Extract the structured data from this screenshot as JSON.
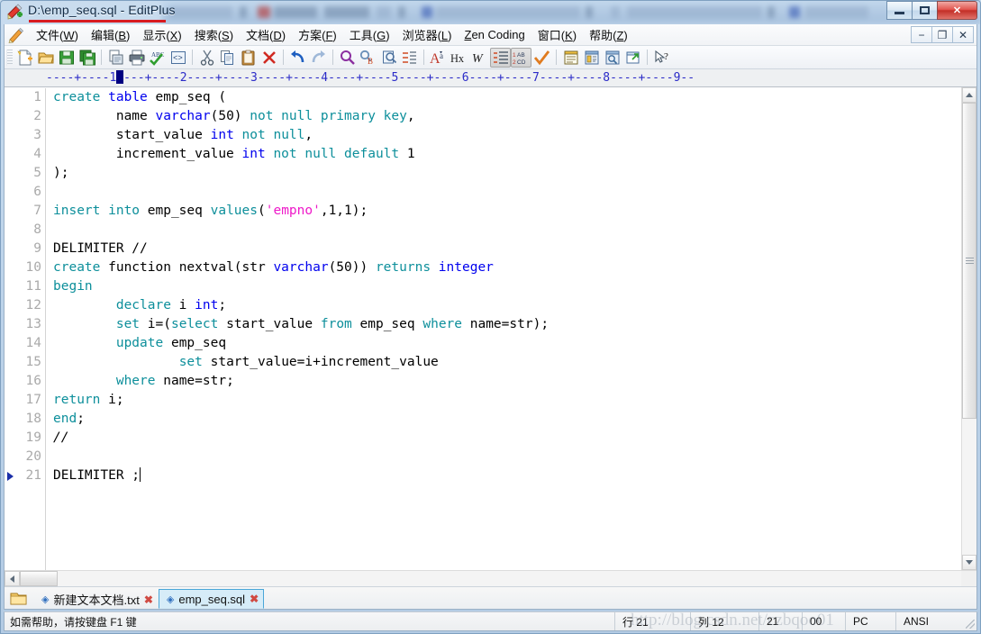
{
  "window": {
    "title": "D:\\emp_seq.sql - EditPlus",
    "app_icon": "editplus-icon",
    "minimize_label": "",
    "maximize_label": "",
    "close_label": "✕"
  },
  "menubar": {
    "leading_icon": "pencil-icon",
    "items": [
      {
        "name": "file",
        "text": "文件(W)",
        "accel": "W"
      },
      {
        "name": "edit",
        "text": "编辑(B)",
        "accel": "B"
      },
      {
        "name": "view",
        "text": "显示(X)",
        "accel": "X"
      },
      {
        "name": "search",
        "text": "搜索(S)",
        "accel": "S"
      },
      {
        "name": "document",
        "text": "文档(D)",
        "accel": "D"
      },
      {
        "name": "project",
        "text": "方案(F)",
        "accel": "F"
      },
      {
        "name": "tools",
        "text": "工具(G)",
        "accel": "G"
      },
      {
        "name": "browser",
        "text": "浏览器(L)",
        "accel": "L"
      },
      {
        "name": "zencoding",
        "text": "Zen Coding",
        "accel": "Z"
      },
      {
        "name": "window",
        "text": "窗口(K)",
        "accel": "K"
      },
      {
        "name": "help",
        "text": "帮助(Z)",
        "accel": "Z"
      }
    ],
    "mdi_buttons": [
      {
        "name": "mdi-minimize",
        "glyph": "−"
      },
      {
        "name": "mdi-restore",
        "glyph": "❐"
      },
      {
        "name": "mdi-close",
        "glyph": "✕"
      }
    ]
  },
  "toolbar": {
    "buttons": [
      {
        "name": "new-file-icon",
        "group": 0
      },
      {
        "name": "open-file-icon",
        "group": 0
      },
      {
        "name": "save-icon",
        "group": 0
      },
      {
        "name": "save-all-icon",
        "group": 0
      },
      {
        "name": "print-preview-icon",
        "group": 1
      },
      {
        "name": "print-icon",
        "group": 1
      },
      {
        "name": "spell-check-icon",
        "group": 1
      },
      {
        "name": "html-tag-icon",
        "group": 1
      },
      {
        "name": "cut-icon",
        "group": 2
      },
      {
        "name": "copy-icon",
        "group": 2
      },
      {
        "name": "paste-icon",
        "group": 2
      },
      {
        "name": "delete-icon",
        "group": 2
      },
      {
        "name": "undo-icon",
        "group": 3
      },
      {
        "name": "redo-icon",
        "group": 3
      },
      {
        "name": "find-icon",
        "group": 4
      },
      {
        "name": "replace-icon",
        "group": 4
      },
      {
        "name": "find-in-files-icon",
        "group": 4
      },
      {
        "name": "goto-line-icon",
        "group": 4
      },
      {
        "name": "font-icon",
        "group": 5
      },
      {
        "name": "hex-view-icon",
        "group": 5
      },
      {
        "name": "word-wrap-icon",
        "group": 5
      },
      {
        "name": "line-numbers-icon",
        "group": 5,
        "pressed": true
      },
      {
        "name": "whitespace-icon",
        "group": 5,
        "pressed": true
      },
      {
        "name": "check-mark-icon",
        "group": 5
      },
      {
        "name": "directory-window-icon",
        "group": 6
      },
      {
        "name": "cliptext-window-icon",
        "group": 6
      },
      {
        "name": "preview-window-icon",
        "group": 6
      },
      {
        "name": "browser-window-icon",
        "group": 6
      },
      {
        "name": "context-help-icon",
        "group": 7
      }
    ]
  },
  "ruler": {
    "text": "----+----1----+----2----+----3----+----4----+----5----+----6----+----7----+----8----+----9--",
    "cursor_column": 11
  },
  "editor": {
    "line_count": 21,
    "bookmark_line": 21,
    "lines": [
      {
        "n": 1,
        "tokens": [
          {
            "t": "create",
            "c": "kw"
          },
          {
            "t": " ",
            "c": "plain"
          },
          {
            "t": "table",
            "c": "typ"
          },
          {
            "t": " emp_seq (",
            "c": "plain"
          }
        ]
      },
      {
        "n": 2,
        "tokens": [
          {
            "t": "        name ",
            "c": "plain"
          },
          {
            "t": "varchar",
            "c": "typ"
          },
          {
            "t": "(50) ",
            "c": "plain"
          },
          {
            "t": "not null",
            "c": "kw"
          },
          {
            "t": " ",
            "c": "plain"
          },
          {
            "t": "primary key",
            "c": "kw"
          },
          {
            "t": ",",
            "c": "plain"
          }
        ]
      },
      {
        "n": 3,
        "tokens": [
          {
            "t": "        start_value ",
            "c": "plain"
          },
          {
            "t": "int",
            "c": "typ"
          },
          {
            "t": " ",
            "c": "plain"
          },
          {
            "t": "not null",
            "c": "kw"
          },
          {
            "t": ",",
            "c": "plain"
          }
        ]
      },
      {
        "n": 4,
        "tokens": [
          {
            "t": "        increment_value ",
            "c": "plain"
          },
          {
            "t": "int",
            "c": "typ"
          },
          {
            "t": " ",
            "c": "plain"
          },
          {
            "t": "not null",
            "c": "kw"
          },
          {
            "t": " ",
            "c": "plain"
          },
          {
            "t": "default",
            "c": "kw"
          },
          {
            "t": " 1",
            "c": "plain"
          }
        ]
      },
      {
        "n": 5,
        "tokens": [
          {
            "t": ");",
            "c": "plain"
          }
        ]
      },
      {
        "n": 6,
        "tokens": []
      },
      {
        "n": 7,
        "tokens": [
          {
            "t": "insert into",
            "c": "kw"
          },
          {
            "t": " emp_seq ",
            "c": "plain"
          },
          {
            "t": "values",
            "c": "kw"
          },
          {
            "t": "(",
            "c": "plain"
          },
          {
            "t": "'empno'",
            "c": "str"
          },
          {
            "t": ",1,1);",
            "c": "plain"
          }
        ]
      },
      {
        "n": 8,
        "tokens": []
      },
      {
        "n": 9,
        "tokens": [
          {
            "t": "DELIMITER //",
            "c": "plain"
          }
        ]
      },
      {
        "n": 10,
        "tokens": [
          {
            "t": "create",
            "c": "kw"
          },
          {
            "t": " function nextval(str ",
            "c": "plain"
          },
          {
            "t": "varchar",
            "c": "typ"
          },
          {
            "t": "(50)) ",
            "c": "plain"
          },
          {
            "t": "returns",
            "c": "kw"
          },
          {
            "t": " ",
            "c": "plain"
          },
          {
            "t": "integer",
            "c": "typ"
          }
        ]
      },
      {
        "n": 11,
        "tokens": [
          {
            "t": "begin",
            "c": "kw"
          }
        ]
      },
      {
        "n": 12,
        "tokens": [
          {
            "t": "        ",
            "c": "plain"
          },
          {
            "t": "declare",
            "c": "kw"
          },
          {
            "t": " i ",
            "c": "plain"
          },
          {
            "t": "int",
            "c": "typ"
          },
          {
            "t": ";",
            "c": "plain"
          }
        ]
      },
      {
        "n": 13,
        "tokens": [
          {
            "t": "        ",
            "c": "plain"
          },
          {
            "t": "set",
            "c": "kw"
          },
          {
            "t": " i=(",
            "c": "plain"
          },
          {
            "t": "select",
            "c": "kw"
          },
          {
            "t": " start_value ",
            "c": "plain"
          },
          {
            "t": "from",
            "c": "kw"
          },
          {
            "t": " emp_seq ",
            "c": "plain"
          },
          {
            "t": "where",
            "c": "kw"
          },
          {
            "t": " name=str);",
            "c": "plain"
          }
        ]
      },
      {
        "n": 14,
        "tokens": [
          {
            "t": "        ",
            "c": "plain"
          },
          {
            "t": "update",
            "c": "kw"
          },
          {
            "t": " emp_seq",
            "c": "plain"
          }
        ]
      },
      {
        "n": 15,
        "tokens": [
          {
            "t": "                ",
            "c": "plain"
          },
          {
            "t": "set",
            "c": "kw"
          },
          {
            "t": " start_value=i+increment_value",
            "c": "plain"
          }
        ]
      },
      {
        "n": 16,
        "tokens": [
          {
            "t": "        ",
            "c": "plain"
          },
          {
            "t": "where",
            "c": "kw"
          },
          {
            "t": " name=str;",
            "c": "plain"
          }
        ]
      },
      {
        "n": 17,
        "tokens": [
          {
            "t": "return",
            "c": "kw"
          },
          {
            "t": " i;",
            "c": "plain"
          }
        ]
      },
      {
        "n": 18,
        "tokens": [
          {
            "t": "end",
            "c": "kw"
          },
          {
            "t": ";",
            "c": "plain"
          }
        ]
      },
      {
        "n": 19,
        "tokens": [
          {
            "t": "//",
            "c": "cmt"
          }
        ]
      },
      {
        "n": 20,
        "tokens": []
      },
      {
        "n": 21,
        "tokens": [
          {
            "t": "DELIMITER ;",
            "c": "plain"
          }
        ],
        "caret_after": true
      }
    ],
    "colors": {
      "keyword": "#0d8f9b",
      "datatype": "#0000ee",
      "string": "#ee19c9",
      "plain": "#000000",
      "line_number": "#aaaaaa",
      "background": "#ffffff",
      "ruler_text": "#2b2bc8",
      "ruler_cursor": "#000080"
    }
  },
  "tabs": {
    "folder_icon": "folder-icon",
    "items": [
      {
        "name": "tab-new-text-document",
        "label": "新建文本文档.txt",
        "active": false,
        "dot": "◈",
        "close": "✖"
      },
      {
        "name": "tab-emp-seq-sql",
        "label": "emp_seq.sql",
        "active": true,
        "dot": "◈",
        "close": "✖"
      }
    ]
  },
  "statusbar": {
    "message": "如需帮助，请按键盘 F1 键",
    "row": "行 21",
    "col": "列 12",
    "char": "21",
    "sel": "00",
    "eol": "PC",
    "encoding": "ANSI"
  },
  "watermark": {
    "text": "http://blog.csdn.net/czbqoo01"
  }
}
